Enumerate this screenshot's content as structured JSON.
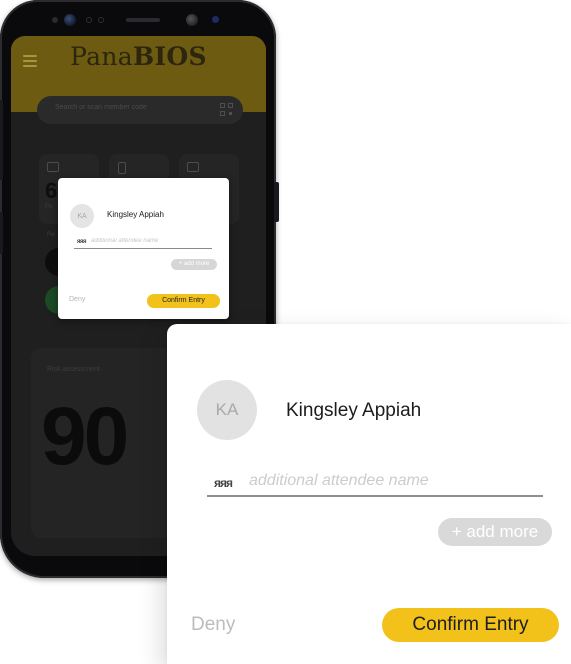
{
  "app": {
    "brand_regular": "Pana",
    "brand_bold": "BIOS",
    "search_placeholder": "Search or scan member code",
    "stats": [
      {
        "icon": "calendar-icon",
        "value": "6",
        "label": "Pe"
      },
      {
        "icon": "phone-icon",
        "value": "",
        "label": ""
      },
      {
        "icon": "calendar-icon",
        "value": "",
        "label": ""
      }
    ],
    "recent_label": "Re",
    "risk": {
      "label": "Risk assessment",
      "value": "90"
    }
  },
  "dialog": {
    "avatar_initials": "KA",
    "member_name": "Kingsley Appiah",
    "attendee_icon": "group-icon",
    "attendee_icon_glyph": "ᴙᴙᴙ",
    "attendee_placeholder": "additional attendee name",
    "add_more_label": "+ add more",
    "deny_label": "Deny",
    "confirm_label": "Confirm Entry"
  },
  "colors": {
    "accent": "#f2c21a",
    "header_dimmed": "#6e5b12",
    "overlay_bg": "#1f1f1f"
  }
}
